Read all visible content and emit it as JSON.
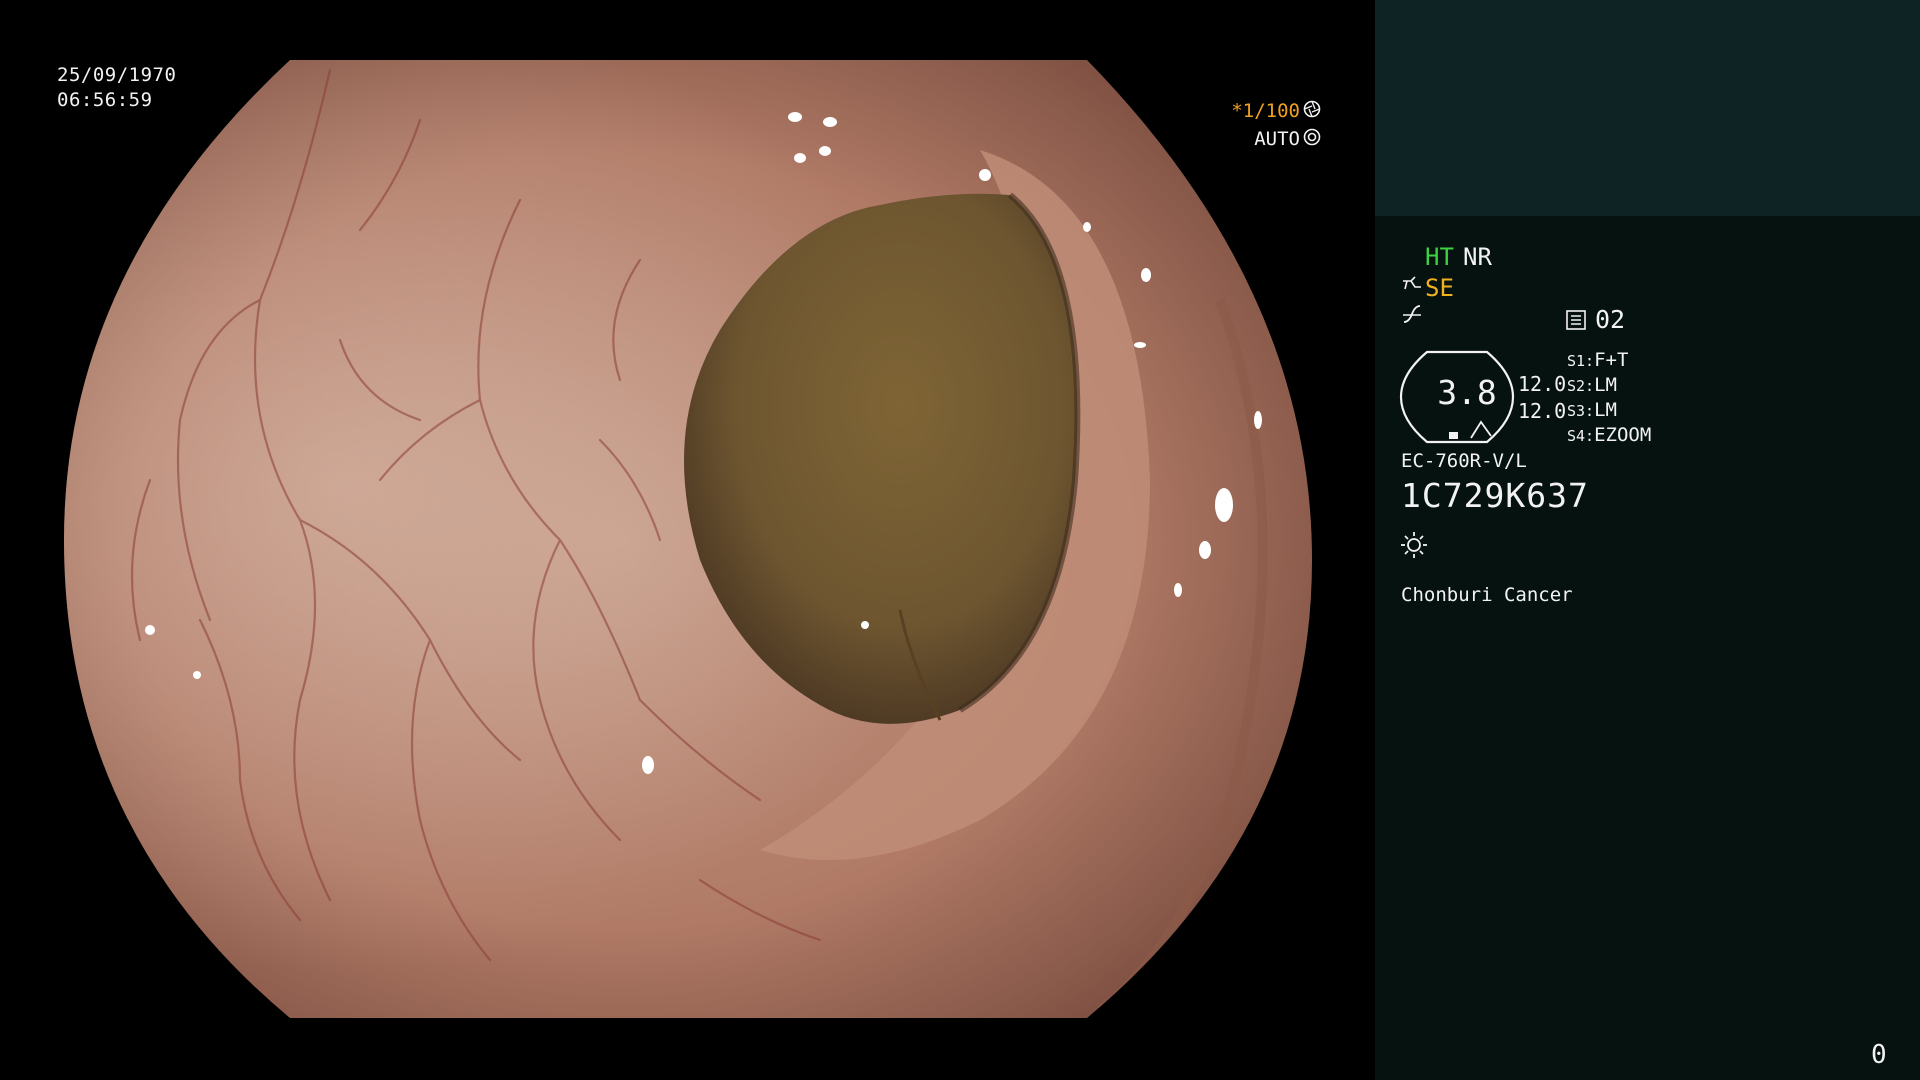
{
  "overlay": {
    "date": "25/09/1970",
    "time": "06:56:59",
    "shutter": "*1/100",
    "exposure_mode": "AUTO"
  },
  "panel": {
    "ht_label": "HT",
    "nr_label": "NR",
    "se_label": "SE",
    "memory_slot": "02",
    "gauge_value": "3.8",
    "readout_1": "12.0",
    "readout_2": "12.0",
    "switches": [
      {
        "key": "S1:",
        "value": "F+T"
      },
      {
        "key": "S2:",
        "value": "LM"
      },
      {
        "key": "S3:",
        "value": "LM"
      },
      {
        "key": "S4:",
        "value": "EZOOM"
      }
    ],
    "scope_model": "EC-760R-V/L",
    "serial": "1C729K637",
    "hospital": "Chonburi Cancer",
    "image_count": "0"
  },
  "colors": {
    "panel_bg": "#061210",
    "panel_top_bg": "#0e2324",
    "ht_green": "#3fd13f",
    "se_amber": "#f0b020",
    "shutter_orange": "#f0a020"
  },
  "icons": [
    "aperture-icon",
    "iris-icon",
    "scope-tip-icon",
    "curve-icon",
    "memory-icon",
    "light-source-icon"
  ]
}
